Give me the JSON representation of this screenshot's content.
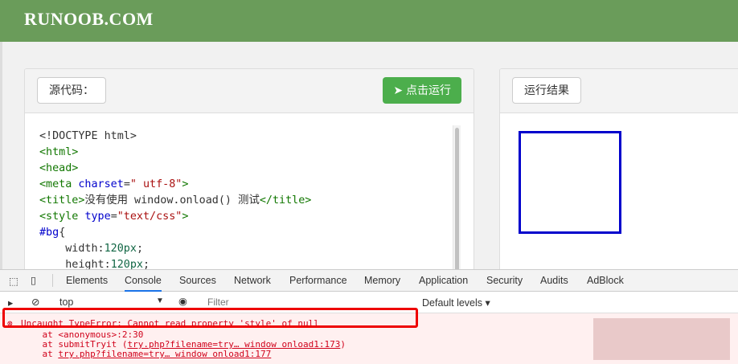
{
  "header": {
    "logo": "RUNOOB.COM"
  },
  "editor": {
    "label": "源代码：",
    "run_label": "点击运行",
    "run_icon": "paper-plane-icon",
    "lines": [
      [
        [
          "<!DOCTYPE html>",
          "#333"
        ]
      ],
      [
        [
          "<html>",
          "#117700"
        ]
      ],
      [
        [
          "<head>",
          "#117700"
        ]
      ],
      [
        [
          "<meta ",
          "#117700"
        ],
        [
          "charset",
          "#0000cc"
        ],
        [
          "=",
          "#333"
        ],
        [
          "\" utf-8\"",
          "#aa1111"
        ],
        [
          ">",
          "#117700"
        ]
      ],
      [
        [
          "<title>",
          "#117700"
        ],
        [
          "没有使用 window.onload() 测试",
          "#333"
        ],
        [
          "</title>",
          "#117700"
        ]
      ],
      [
        [
          "<style ",
          "#117700"
        ],
        [
          "type",
          "#0000cc"
        ],
        [
          "=",
          "#333"
        ],
        [
          "\"text/css\"",
          "#aa1111"
        ],
        [
          ">",
          "#117700"
        ]
      ],
      [
        [
          "#bg",
          "#0000cc"
        ],
        [
          "{",
          "#333"
        ]
      ],
      [
        [
          "    width:",
          "#333"
        ],
        [
          "120px",
          "#116644"
        ],
        [
          ";",
          "#333"
        ]
      ],
      [
        [
          "    height:",
          "#333"
        ],
        [
          "120px",
          "#116644"
        ],
        [
          ";",
          "#333"
        ]
      ]
    ]
  },
  "result": {
    "label": "运行结果",
    "box_color": "#0000cc"
  },
  "devtools": {
    "tabs": [
      "Elements",
      "Console",
      "Sources",
      "Network",
      "Performance",
      "Memory",
      "Application",
      "Security",
      "Audits",
      "AdBlock"
    ],
    "active_tab": "Console",
    "context": "top",
    "filter_placeholder": "Filter",
    "levels": "Default levels ▾",
    "error": "Uncaught TypeError: Cannot read property 'style' of null",
    "stack": [
      {
        "pre": "    at ",
        "link": "",
        "text": "<anonymous>:2:30"
      },
      {
        "pre": "    at submitTryit (",
        "link": "try.php?filename=try… window onload1:173",
        "post": ")"
      },
      {
        "pre": "    at ",
        "link": "try.php?filename=try… window onload1:177",
        "post": ""
      }
    ]
  }
}
